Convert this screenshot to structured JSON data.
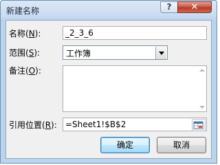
{
  "dialog": {
    "title": "新建名称",
    "help_label": "?",
    "close_label": "✕"
  },
  "form": {
    "name": {
      "label_prefix": "名称(",
      "label_key": "N",
      "label_suffix": "):",
      "value": "_2_3_6"
    },
    "scope": {
      "label_prefix": "范围(",
      "label_key": "S",
      "label_suffix": "):",
      "value": "工作簿"
    },
    "comment": {
      "label_prefix": "备注(",
      "label_key": "O",
      "label_suffix": "):",
      "value": ""
    },
    "refers_to": {
      "label_prefix": "引用位置(",
      "label_key": "R",
      "label_suffix": "):",
      "value": "=Sheet1!$B$2"
    }
  },
  "buttons": {
    "ok": "确定",
    "cancel": "取消"
  },
  "colors": {
    "close_red": "#c75a49",
    "default_button_blue": "#a7d9f5"
  }
}
